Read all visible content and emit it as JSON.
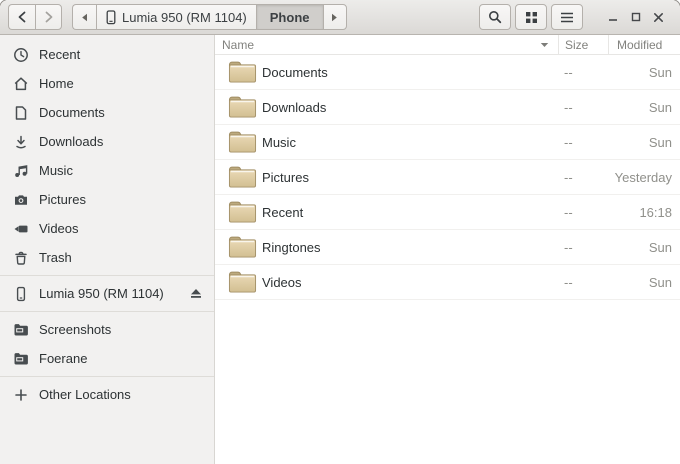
{
  "header": {
    "path_device": {
      "label": "Lumia 950 (RM 1104)"
    },
    "path_current": {
      "label": "Phone"
    }
  },
  "sidebar": {
    "items": [
      {
        "label": "Recent",
        "icon": "clock-icon"
      },
      {
        "label": "Home",
        "icon": "home-icon"
      },
      {
        "label": "Documents",
        "icon": "document-icon"
      },
      {
        "label": "Downloads",
        "icon": "download-icon"
      },
      {
        "label": "Music",
        "icon": "music-notes-icon"
      },
      {
        "label": "Pictures",
        "icon": "camera-icon"
      },
      {
        "label": "Videos",
        "icon": "video-camera-icon"
      },
      {
        "label": "Trash",
        "icon": "trash-icon"
      }
    ],
    "device": {
      "label": "Lumia 950 (RM 1104)",
      "icon": "phone-icon"
    },
    "bookmarks": [
      {
        "label": "Screenshots",
        "icon": "remote-folder-icon"
      },
      {
        "label": "Foerane",
        "icon": "remote-folder-icon"
      }
    ],
    "other_locations": {
      "label": "Other Locations",
      "icon": "plus-icon"
    }
  },
  "filelist": {
    "columns": {
      "name": "Name",
      "size": "Size",
      "modified": "Modified"
    },
    "sort_column": "Name",
    "sort_direction": "descending-arrow",
    "rows": [
      {
        "name": "Documents",
        "size": "--",
        "modified": "Sun"
      },
      {
        "name": "Downloads",
        "size": "--",
        "modified": "Sun"
      },
      {
        "name": "Music",
        "size": "--",
        "modified": "Sun"
      },
      {
        "name": "Pictures",
        "size": "--",
        "modified": "Yesterday"
      },
      {
        "name": "Recent",
        "size": "--",
        "modified": "16:18"
      },
      {
        "name": "Ringtones",
        "size": "--",
        "modified": "Sun"
      },
      {
        "name": "Videos",
        "size": "--",
        "modified": "Sun"
      }
    ]
  },
  "colors": {
    "headerbar_top": "#edecea",
    "headerbar_bottom": "#dbd9d6",
    "sidebar_bg": "#f2f1f0",
    "active_segment_bg": "#d0cecb",
    "folder_body_light": "#ead9b5",
    "folder_body_dark": "#d2bf92",
    "folder_tab": "#bdaa7e",
    "folder_border": "#a5926a",
    "text_primary": "#2d3234",
    "text_secondary": "#90908b"
  }
}
